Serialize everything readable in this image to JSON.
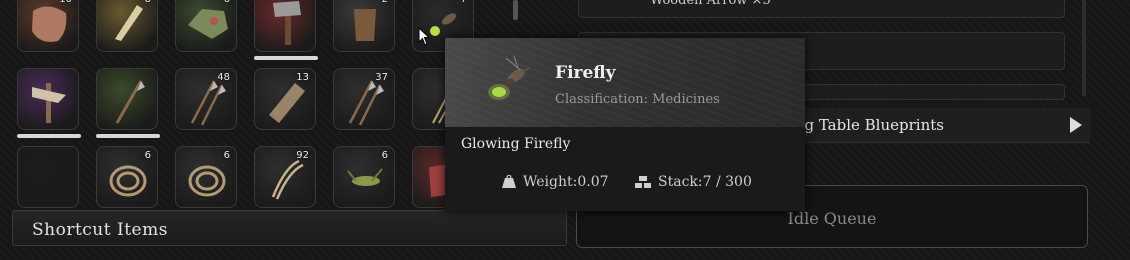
{
  "inventory": {
    "slots": [
      {
        "icon": "leather-hide-icon",
        "count": "10",
        "tint": "#5a3a2a"
      },
      {
        "icon": "bone-shard-icon",
        "count": "8",
        "tint": "#6a5a30"
      },
      {
        "icon": "ore-chunk-icon",
        "count": "6",
        "tint": "#3a4a30"
      },
      {
        "icon": "stone-hammer-icon",
        "count": "",
        "tint": "#6a2a2a"
      },
      {
        "icon": "wooden-bucket-icon",
        "count": "2",
        "tint": "#3a3a3a"
      },
      {
        "icon": "firefly-icon",
        "count": "7",
        "tint": "#2a2a2a"
      },
      {
        "icon": "feathered-totem-icon",
        "count": "",
        "tint": "#4a2a5a"
      },
      {
        "icon": "spear-icon",
        "count": "",
        "tint": "#3a4a2a"
      },
      {
        "icon": "arrows-icon",
        "count": "48",
        "tint": "#2e2e2e"
      },
      {
        "icon": "bark-icon",
        "count": "13",
        "tint": "#2e2e2e"
      },
      {
        "icon": "arrows-icon",
        "count": "37",
        "tint": "#2e2e2e"
      },
      {
        "icon": "straw-bundle-icon",
        "count": "",
        "tint": "#2e2e2e"
      },
      {
        "icon": "empty-slot-icon",
        "count": "",
        "tint": "#1c1c1c"
      },
      {
        "icon": "rope-coil-icon",
        "count": "6",
        "tint": "#2e2e2e"
      },
      {
        "icon": "rope-coil-icon",
        "count": "6",
        "tint": "#2e2e2e"
      },
      {
        "icon": "fiber-bundle-icon",
        "count": "92",
        "tint": "#2e2e2e"
      },
      {
        "icon": "grasshopper-icon",
        "count": "6",
        "tint": "#2e2e2e"
      },
      {
        "icon": "raw-meat-icon",
        "count": "",
        "tint": "#5a2a2a"
      }
    ]
  },
  "shortcut": {
    "label": "Shortcut Items"
  },
  "tooltip": {
    "name": "Firefly",
    "classification": "Classification: Medicines",
    "description": "Glowing Firefly",
    "weight_label": "Weight:",
    "weight_value": "0.07",
    "stack_label": "Stack:",
    "stack_value": "7 / 300",
    "icon": "firefly-icon"
  },
  "crafting": {
    "arrow_item": "Wooden Arrow ×5",
    "blueprints_label": "ing Table Blueprints",
    "idle_queue": "Idle Queue"
  },
  "colors": {
    "accent_green": "#9ccc3a",
    "underline": "#d8d8d8"
  }
}
